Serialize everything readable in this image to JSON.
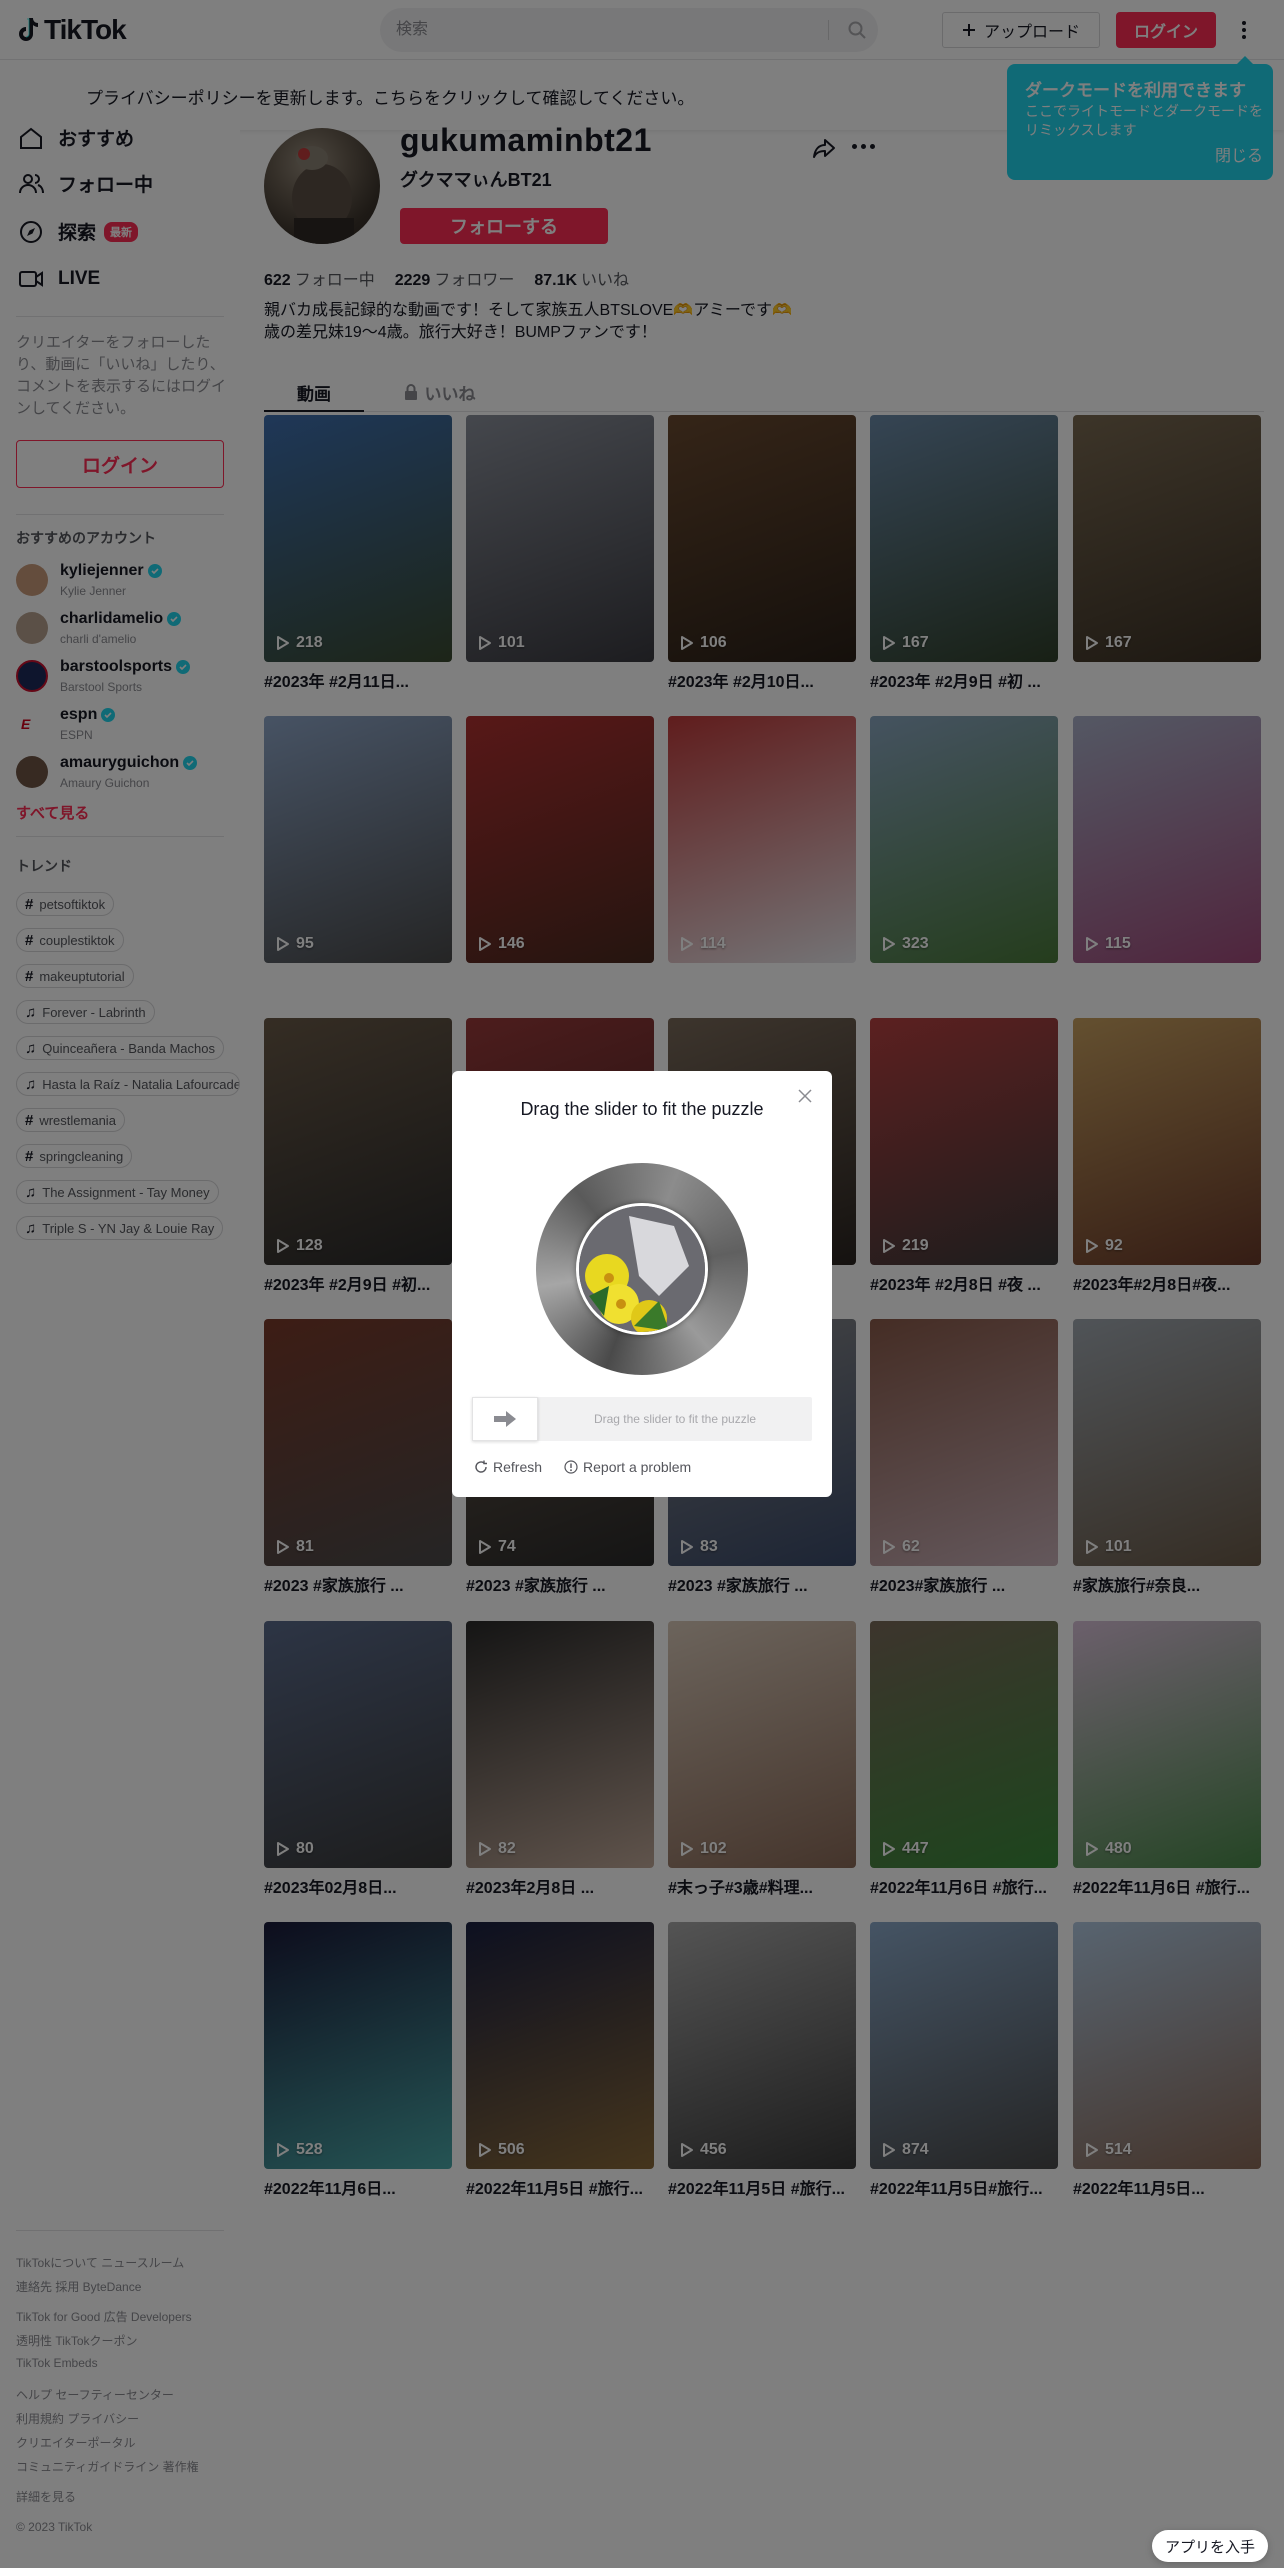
{
  "header": {
    "logo_text": "TikTok",
    "search_placeholder": "検索",
    "upload_label": "アップロード",
    "login_label": "ログイン"
  },
  "privacy_banner": "プライバシーポリシーを更新します。こちらをクリックして確認してください。",
  "dark_mode_popup": {
    "title": "ダークモードを利用できます",
    "description": "ここでライトモードとダークモードをリミックスします",
    "close_label": "閉じる"
  },
  "sidebar": {
    "nav": [
      {
        "label": "おすすめ",
        "icon": "home-icon"
      },
      {
        "label": "フォロー中",
        "icon": "people-icon"
      },
      {
        "label": "探索",
        "icon": "compass-icon",
        "badge": "最新"
      },
      {
        "label": "LIVE",
        "icon": "live-icon"
      }
    ],
    "login_hint": "クリエイターをフォローしたり、動画に「いいね」したり、コメントを表示するにはログインしてください。",
    "login_label": "ログイン",
    "suggested_heading": "おすすめのアカウント",
    "accounts": [
      {
        "username": "kyliejenner",
        "display": "Kylie Jenner",
        "color": "#c99a7a"
      },
      {
        "username": "charlidamelio",
        "display": "charli d'amelio",
        "color": "#b7a18f"
      },
      {
        "username": "barstoolsports",
        "display": "Barstool Sports",
        "color": "#1c2b5a"
      },
      {
        "username": "espn",
        "display": "ESPN",
        "color": "#ffffff"
      },
      {
        "username": "amauryguichon",
        "display": "Amaury Guichon",
        "color": "#6e5545"
      }
    ],
    "see_all": "すべて見る",
    "trends_heading": "トレンド",
    "trends": [
      {
        "type": "hashtag",
        "label": "petsoftiktok"
      },
      {
        "type": "hashtag",
        "label": "couplestiktok"
      },
      {
        "type": "hashtag",
        "label": "makeuptutorial"
      },
      {
        "type": "music",
        "label": "Forever - Labrinth"
      },
      {
        "type": "music",
        "label": "Quinceañera - Banda Machos"
      },
      {
        "type": "music",
        "label": "Hasta la Raíz - Natalia Lafourcade"
      },
      {
        "type": "hashtag",
        "label": "wrestlemania"
      },
      {
        "type": "hashtag",
        "label": "springcleaning"
      },
      {
        "type": "music",
        "label": "The Assignment - Tay Money"
      },
      {
        "type": "music",
        "label": "Triple S - YN Jay & Louie Ray"
      }
    ],
    "footer": [
      "TikTokについて  ニュースルーム",
      "連絡先  採用  ByteDance",
      "TikTok for Good  広告  Developers",
      "透明性  TikTokクーポン",
      "TikTok Embeds",
      "ヘルプ  セーフティーセンター",
      "利用規約  プライバシー",
      "クリエイターポータル",
      "コミュニティガイドライン  著作権",
      "詳細を見る",
      "© 2023 TikTok"
    ]
  },
  "profile": {
    "username": "gukumaminbt21",
    "display_name": "グクママぃんBT21",
    "follow_label": "フォローする",
    "following_count": "622",
    "following_label": "フォロー中",
    "followers_count": "2229",
    "followers_label": "フォロワー",
    "likes_count": "87.1K",
    "likes_label": "いいね",
    "bio": "親バカ成長記録的な動画です！そして家族五人BTSLOVE🫶アミーです🫶歳の差兄妹19～4歳。旅行大好き！BUMPファンです！",
    "tab_videos": "動画",
    "tab_likes": "いいね"
  },
  "videos": [
    {
      "views": "218",
      "caption": "#2023年 #2月11日...",
      "c1": "#3e6fb0",
      "c2": "#3a4a30"
    },
    {
      "views": "101",
      "caption": "",
      "c1": "#8a8f9a",
      "c2": "#3a3a40"
    },
    {
      "views": "106",
      "caption": "#2023年 #2月10日...",
      "c1": "#6a4a30",
      "c2": "#2a2018"
    },
    {
      "views": "167",
      "caption": "#2023年 #2月9日 #初 ...",
      "c1": "#6b8aa8",
      "c2": "#30402a"
    },
    {
      "views": "167",
      "caption": "",
      "c1": "#7a6a52",
      "c2": "#3a3024"
    },
    {
      "views": "95",
      "caption": "",
      "c1": "#8ea6c8",
      "c2": "#4a4a4a"
    },
    {
      "views": "146",
      "caption": "",
      "c1": "#b03030",
      "c2": "#4a2a20"
    },
    {
      "views": "114",
      "caption": "",
      "c1": "#c03a3a",
      "c2": "#e8e8ec"
    },
    {
      "views": "323",
      "caption": "",
      "c1": "#8aa6c0",
      "c2": "#4a7a3a"
    },
    {
      "views": "115",
      "caption": "",
      "c1": "#a8b0c8",
      "c2": "#a04a7a"
    },
    {
      "views": "128",
      "caption": "#2023年 #2月9日 #初...",
      "c1": "#6a5a48",
      "c2": "#2a2a2a"
    },
    {
      "views": "",
      "caption": "",
      "c1": "#9a3a3a",
      "c2": "#3a2020"
    },
    {
      "views": "",
      "caption": "",
      "c1": "#7a6a5a",
      "c2": "#2a2420"
    },
    {
      "views": "219",
      "caption": "#2023年 #2月8日 #夜 ...",
      "c1": "#b84040",
      "c2": "#3a3a3a"
    },
    {
      "views": "92",
      "caption": "#2023年#2月8日#夜...",
      "c1": "#c8a060",
      "c2": "#6a3a2a"
    },
    {
      "views": "81",
      "caption": "#2023 #家族旅行 ...",
      "c1": "#7a3a2a",
      "c2": "#4a4a4a"
    },
    {
      "views": "74",
      "caption": "#2023 #家族旅行 ...",
      "c1": "#6a5a4a",
      "c2": "#2a2a2a"
    },
    {
      "views": "83",
      "caption": "#2023 #家族旅行 ...",
      "c1": "#8a8a8a",
      "c2": "#3a4a6a"
    },
    {
      "views": "62",
      "caption": "#2023#家族旅行 ...",
      "c1": "#8a5a4a",
      "c2": "#c8b0b8"
    },
    {
      "views": "101",
      "caption": "#家族旅行#奈良...",
      "c1": "#a0a8b0",
      "c2": "#6a5a48"
    },
    {
      "views": "80",
      "caption": "#2023年02月8日...",
      "c1": "#5a6a8a",
      "c2": "#3a3a3a"
    },
    {
      "views": "82",
      "caption": "#2023年2月8日 ...",
      "c1": "#2a2a2a",
      "c2": "#c0a898"
    },
    {
      "views": "102",
      "caption": "#末っ子#3歳#料理...",
      "c1": "#d8c8b8",
      "c2": "#8a6a58"
    },
    {
      "views": "447",
      "caption": "#2022年11月6日 #旅行...",
      "c1": "#7a6a5a",
      "c2": "#3a8a3a"
    },
    {
      "views": "480",
      "caption": "#2022年11月6日 #旅行...",
      "c1": "#d8c0d8",
      "c2": "#4a8a4a"
    },
    {
      "views": "528",
      "caption": "#2022年11月6日...",
      "c1": "#1a1a3a",
      "c2": "#4aa8a8"
    },
    {
      "views": "506",
      "caption": "#2022年11月5日 #旅行...",
      "c1": "#1a2040",
      "c2": "#8a6a3a"
    },
    {
      "views": "456",
      "caption": "#2022年11月5日 #旅行...",
      "c1": "#a8a8a8",
      "c2": "#3a3a3a"
    },
    {
      "views": "874",
      "caption": "#2022年11月5日#旅行...",
      "c1": "#8aa8c8",
      "c2": "#4a4a4a"
    },
    {
      "views": "514",
      "caption": "#2022年11月5日...",
      "c1": "#b0c8e0",
      "c2": "#8a6a58"
    }
  ],
  "captcha": {
    "title": "Drag the slider to fit the puzzle",
    "slider_hint": "Drag the slider to fit the puzzle",
    "refresh_label": "Refresh",
    "report_label": "Report a problem"
  },
  "app_button": "アプリを入手",
  "colors": {
    "accent": "#fe2c55",
    "popup": "#20d5ec",
    "overlay": "rgba(0,0,0,0.5)"
  }
}
